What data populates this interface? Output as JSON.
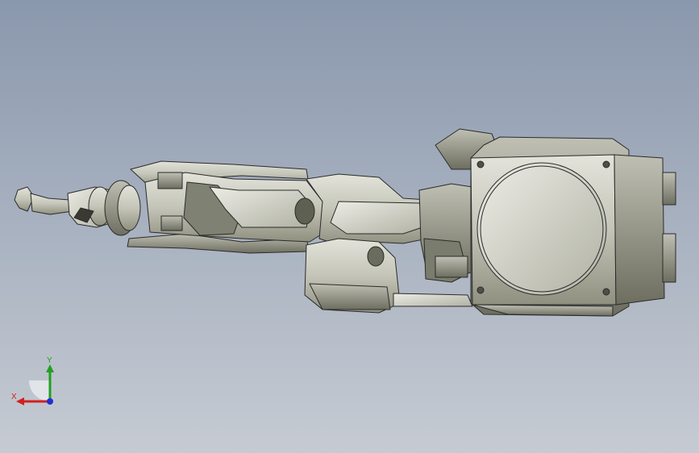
{
  "viewport": {
    "background_top": "#8a98ad",
    "background_bottom": "#c6cbd3",
    "model_color": "#c9cabd",
    "edge_color": "#2b2b2b"
  },
  "triad": {
    "x_label": "X",
    "y_label": "Y",
    "x_color": "#d22020",
    "y_color": "#20a020",
    "z_color": "#2030d0"
  }
}
